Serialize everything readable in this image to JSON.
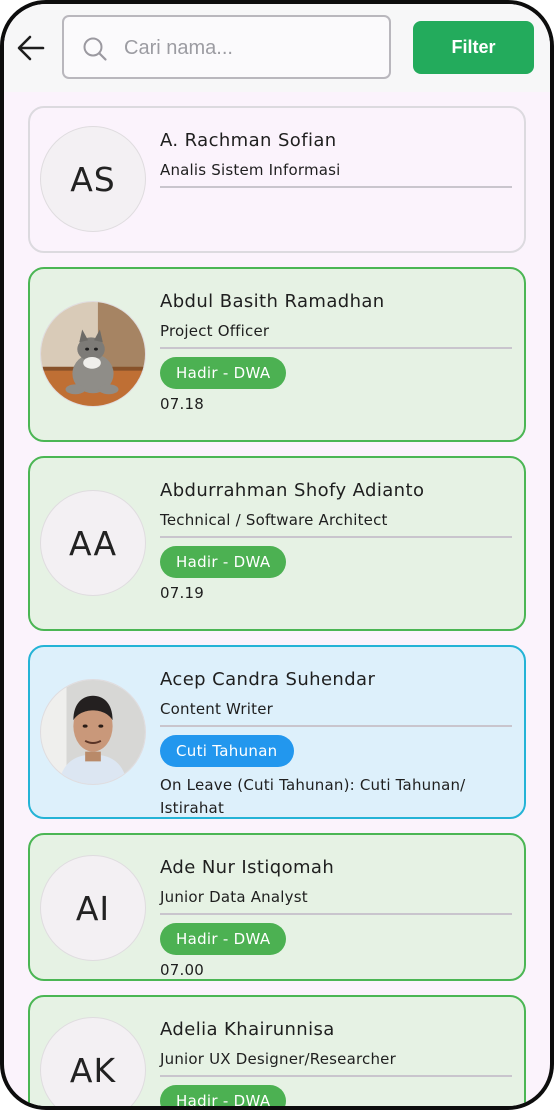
{
  "header": {
    "back_icon": "arrow-left-icon",
    "search_icon": "search-icon",
    "search_placeholder": "Cari nama...",
    "search_value": "",
    "filter_label": "Filter"
  },
  "colors": {
    "filter_button": "#23ab5c",
    "hadir_badge": "#4cb152",
    "cuti_badge": "#2297ee",
    "hadir_card_border": "#4bb654",
    "cuti_card_border": "#24b3d6"
  },
  "employees": [
    {
      "initials": "AS",
      "avatar_type": "initials",
      "name": "A. Rachman Sofian",
      "role": "Analis Sistem Informasi",
      "status": "",
      "meta": ""
    },
    {
      "initials": "",
      "avatar_type": "cat-photo",
      "name": "Abdul Basith Ramadhan",
      "role": "Project Officer",
      "status": "Hadir - DWA",
      "meta": "07.18"
    },
    {
      "initials": "AA",
      "avatar_type": "initials",
      "name": "Abdurrahman Shofy Adianto",
      "role": "Technical / Software Architect",
      "status": "Hadir - DWA",
      "meta": "07.19"
    },
    {
      "initials": "",
      "avatar_type": "person-photo",
      "name": "Acep Candra Suhendar",
      "role": "Content Writer",
      "status": "Cuti Tahunan",
      "meta": "On Leave (Cuti Tahunan): Cuti Tahunan/ Istirahat"
    },
    {
      "initials": "AI",
      "avatar_type": "initials",
      "name": "Ade Nur Istiqomah",
      "role": "Junior Data Analyst",
      "status": "Hadir - DWA",
      "meta": "07.00"
    },
    {
      "initials": "AK",
      "avatar_type": "initials",
      "name": "Adelia Khairunnisa",
      "role": "Junior UX Designer/Researcher",
      "status": "Hadir - DWA",
      "meta": ""
    }
  ]
}
